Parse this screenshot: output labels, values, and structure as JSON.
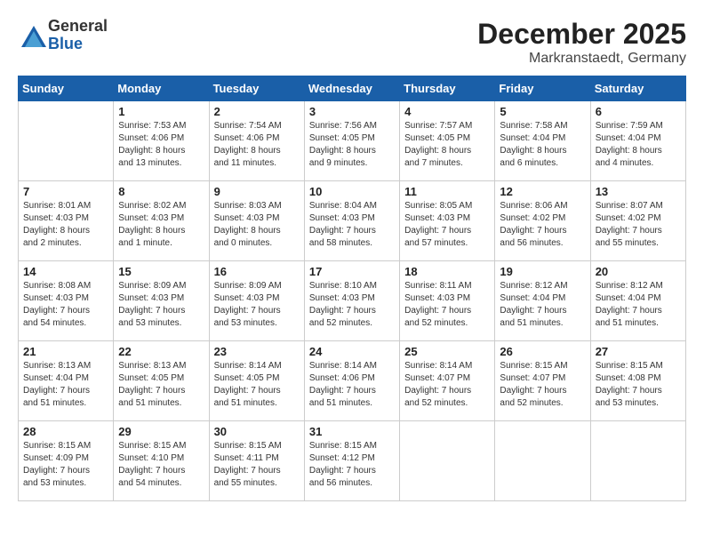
{
  "header": {
    "logo": {
      "general": "General",
      "blue": "Blue"
    },
    "title": "December 2025",
    "location": "Markranstaedt, Germany"
  },
  "weekdays": [
    "Sunday",
    "Monday",
    "Tuesday",
    "Wednesday",
    "Thursday",
    "Friday",
    "Saturday"
  ],
  "weeks": [
    [
      {
        "day": "",
        "info": ""
      },
      {
        "day": "1",
        "info": "Sunrise: 7:53 AM\nSunset: 4:06 PM\nDaylight: 8 hours\nand 13 minutes."
      },
      {
        "day": "2",
        "info": "Sunrise: 7:54 AM\nSunset: 4:06 PM\nDaylight: 8 hours\nand 11 minutes."
      },
      {
        "day": "3",
        "info": "Sunrise: 7:56 AM\nSunset: 4:05 PM\nDaylight: 8 hours\nand 9 minutes."
      },
      {
        "day": "4",
        "info": "Sunrise: 7:57 AM\nSunset: 4:05 PM\nDaylight: 8 hours\nand 7 minutes."
      },
      {
        "day": "5",
        "info": "Sunrise: 7:58 AM\nSunset: 4:04 PM\nDaylight: 8 hours\nand 6 minutes."
      },
      {
        "day": "6",
        "info": "Sunrise: 7:59 AM\nSunset: 4:04 PM\nDaylight: 8 hours\nand 4 minutes."
      }
    ],
    [
      {
        "day": "7",
        "info": "Sunrise: 8:01 AM\nSunset: 4:03 PM\nDaylight: 8 hours\nand 2 minutes."
      },
      {
        "day": "8",
        "info": "Sunrise: 8:02 AM\nSunset: 4:03 PM\nDaylight: 8 hours\nand 1 minute."
      },
      {
        "day": "9",
        "info": "Sunrise: 8:03 AM\nSunset: 4:03 PM\nDaylight: 8 hours\nand 0 minutes."
      },
      {
        "day": "10",
        "info": "Sunrise: 8:04 AM\nSunset: 4:03 PM\nDaylight: 7 hours\nand 58 minutes."
      },
      {
        "day": "11",
        "info": "Sunrise: 8:05 AM\nSunset: 4:03 PM\nDaylight: 7 hours\nand 57 minutes."
      },
      {
        "day": "12",
        "info": "Sunrise: 8:06 AM\nSunset: 4:02 PM\nDaylight: 7 hours\nand 56 minutes."
      },
      {
        "day": "13",
        "info": "Sunrise: 8:07 AM\nSunset: 4:02 PM\nDaylight: 7 hours\nand 55 minutes."
      }
    ],
    [
      {
        "day": "14",
        "info": "Sunrise: 8:08 AM\nSunset: 4:03 PM\nDaylight: 7 hours\nand 54 minutes."
      },
      {
        "day": "15",
        "info": "Sunrise: 8:09 AM\nSunset: 4:03 PM\nDaylight: 7 hours\nand 53 minutes."
      },
      {
        "day": "16",
        "info": "Sunrise: 8:09 AM\nSunset: 4:03 PM\nDaylight: 7 hours\nand 53 minutes."
      },
      {
        "day": "17",
        "info": "Sunrise: 8:10 AM\nSunset: 4:03 PM\nDaylight: 7 hours\nand 52 minutes."
      },
      {
        "day": "18",
        "info": "Sunrise: 8:11 AM\nSunset: 4:03 PM\nDaylight: 7 hours\nand 52 minutes."
      },
      {
        "day": "19",
        "info": "Sunrise: 8:12 AM\nSunset: 4:04 PM\nDaylight: 7 hours\nand 51 minutes."
      },
      {
        "day": "20",
        "info": "Sunrise: 8:12 AM\nSunset: 4:04 PM\nDaylight: 7 hours\nand 51 minutes."
      }
    ],
    [
      {
        "day": "21",
        "info": "Sunrise: 8:13 AM\nSunset: 4:04 PM\nDaylight: 7 hours\nand 51 minutes."
      },
      {
        "day": "22",
        "info": "Sunrise: 8:13 AM\nSunset: 4:05 PM\nDaylight: 7 hours\nand 51 minutes."
      },
      {
        "day": "23",
        "info": "Sunrise: 8:14 AM\nSunset: 4:05 PM\nDaylight: 7 hours\nand 51 minutes."
      },
      {
        "day": "24",
        "info": "Sunrise: 8:14 AM\nSunset: 4:06 PM\nDaylight: 7 hours\nand 51 minutes."
      },
      {
        "day": "25",
        "info": "Sunrise: 8:14 AM\nSunset: 4:07 PM\nDaylight: 7 hours\nand 52 minutes."
      },
      {
        "day": "26",
        "info": "Sunrise: 8:15 AM\nSunset: 4:07 PM\nDaylight: 7 hours\nand 52 minutes."
      },
      {
        "day": "27",
        "info": "Sunrise: 8:15 AM\nSunset: 4:08 PM\nDaylight: 7 hours\nand 53 minutes."
      }
    ],
    [
      {
        "day": "28",
        "info": "Sunrise: 8:15 AM\nSunset: 4:09 PM\nDaylight: 7 hours\nand 53 minutes."
      },
      {
        "day": "29",
        "info": "Sunrise: 8:15 AM\nSunset: 4:10 PM\nDaylight: 7 hours\nand 54 minutes."
      },
      {
        "day": "30",
        "info": "Sunrise: 8:15 AM\nSunset: 4:11 PM\nDaylight: 7 hours\nand 55 minutes."
      },
      {
        "day": "31",
        "info": "Sunrise: 8:15 AM\nSunset: 4:12 PM\nDaylight: 7 hours\nand 56 minutes."
      },
      {
        "day": "",
        "info": ""
      },
      {
        "day": "",
        "info": ""
      },
      {
        "day": "",
        "info": ""
      }
    ]
  ]
}
